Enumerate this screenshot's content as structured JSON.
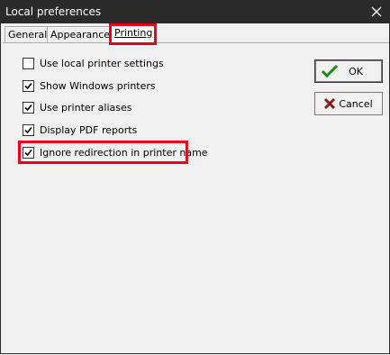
{
  "window": {
    "title": "Local preferences"
  },
  "tabs": [
    {
      "label": "General"
    },
    {
      "label": "Appearance"
    },
    {
      "label": "Printing"
    }
  ],
  "options": [
    {
      "label": "Use local printer settings",
      "checked": false
    },
    {
      "label": "Show Windows printers",
      "checked": true
    },
    {
      "label": "Use printer aliases",
      "checked": true
    },
    {
      "label": "Display PDF reports",
      "checked": true
    },
    {
      "label": "Ignore redirection in printer name",
      "checked": true
    }
  ],
  "buttons": {
    "ok": {
      "label": "OK",
      "icon": "check-icon",
      "color": "#1a8a1a"
    },
    "cancel": {
      "label": "Cancel",
      "icon": "x-icon",
      "color": "#8b1a1a"
    }
  },
  "highlight_color": "#e8001c"
}
